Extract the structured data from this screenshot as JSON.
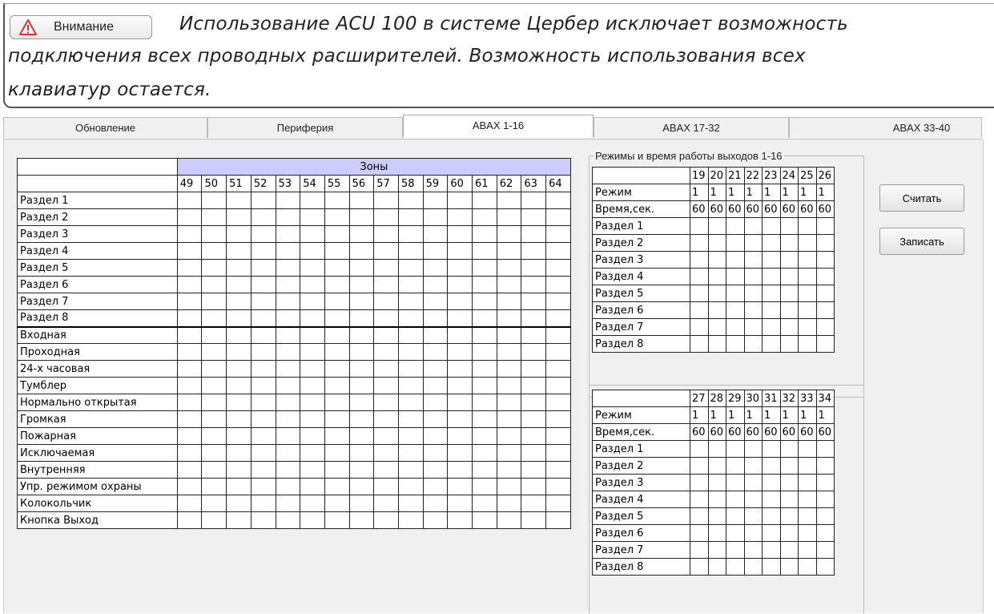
{
  "banner": {
    "button_label": "Внимание",
    "line1": "Использование ACU  100  в системе Цербер исключает возможность",
    "line2": "подключения всех проводных расширителей. Возможность использования всех",
    "line3": "клавиатур остается."
  },
  "tabs": [
    {
      "label": "Обновление"
    },
    {
      "label": "Периферия"
    },
    {
      "label": "ABAX 1-16",
      "active": true
    },
    {
      "label": "ABAX 17-32"
    },
    {
      "label": "ABAX 33-40"
    }
  ],
  "zones": {
    "header": "Зоны",
    "columns": [
      "49",
      "50",
      "51",
      "52",
      "53",
      "54",
      "55",
      "56",
      "57",
      "58",
      "59",
      "60",
      "61",
      "62",
      "63",
      "64"
    ],
    "rows": [
      "Раздел 1",
      "Раздел 2",
      "Раздел 3",
      "Раздел 4",
      "Раздел 5",
      "Раздел 6",
      "Раздел 7",
      "Раздел 8",
      "Входная",
      "Проходная",
      "24-х часовая",
      "Тумблер",
      "Нормально открытая",
      "Громкая",
      "Пожарная",
      "Исключаемая",
      "Внутренняя",
      "Упр. режимом охраны",
      "Колокольчик",
      "Кнопка Выход"
    ]
  },
  "outputs": {
    "legend": "Режимы и время работы выходов 1-16",
    "group1": {
      "columns": [
        "19",
        "20",
        "21",
        "22",
        "23",
        "24",
        "25",
        "26"
      ],
      "mode_label": "Режим",
      "mode_values": [
        "1",
        "1",
        "1",
        "1",
        "1",
        "1",
        "1",
        "1"
      ],
      "time_label": "Время,сек.",
      "time_values": [
        "60",
        "60",
        "60",
        "60",
        "60",
        "60",
        "60",
        "60"
      ],
      "rows": [
        "Раздел 1",
        "Раздел 2",
        "Раздел 3",
        "Раздел 4",
        "Раздел 5",
        "Раздел 6",
        "Раздел 7",
        "Раздел 8"
      ]
    },
    "group2": {
      "columns": [
        "27",
        "28",
        "29",
        "30",
        "31",
        "32",
        "33",
        "34"
      ],
      "mode_label": "Режим",
      "mode_values": [
        "1",
        "1",
        "1",
        "1",
        "1",
        "1",
        "1",
        "1"
      ],
      "time_label": "Время,сек.",
      "time_values": [
        "60",
        "60",
        "60",
        "60",
        "60",
        "60",
        "60",
        "60"
      ],
      "rows": [
        "Раздел 1",
        "Раздел 2",
        "Раздел 3",
        "Раздел 4",
        "Раздел 5",
        "Раздел 6",
        "Раздел 7",
        "Раздел 8"
      ]
    }
  },
  "buttons": {
    "read": "Считать",
    "write": "Записать"
  },
  "icons": {
    "warning": "warning-triangle-icon"
  },
  "colors": {
    "zone_header_bg": "#ccccff",
    "warning_red": "#e03030"
  }
}
